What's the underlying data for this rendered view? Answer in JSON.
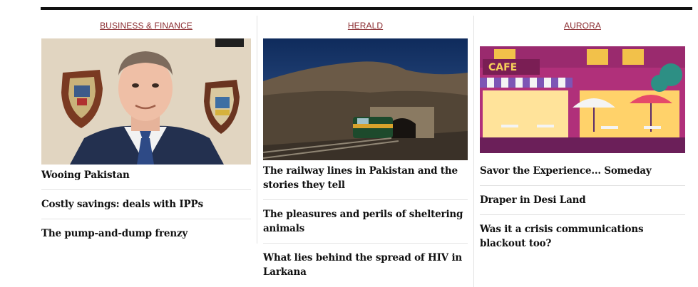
{
  "columns": [
    {
      "section": "BUSINESS & FINANCE",
      "image_icon": "portrait-photo",
      "stories": [
        "Wooing Pakistan",
        "Costly savings: deals with IPPs",
        "The pump-and-dump frenzy"
      ]
    },
    {
      "section": "HERALD",
      "image_icon": "train-tunnel-photo",
      "stories": [
        "The railway lines in Pakistan and the stories they tell",
        "The pleasures and perils of sheltering animals",
        "What lies behind the spread of HIV in Larkana"
      ]
    },
    {
      "section": "AURORA",
      "image_icon": "cafe-illustration",
      "cafe_sign": "CAFE",
      "stories": [
        "Savor the Experience... Someday",
        "Draper in Desi Land",
        "Was it a crisis communications blackout too?"
      ]
    }
  ],
  "colors": {
    "section_link": "#8a2b2f",
    "rule": "#111111",
    "divider": "#e3e3e3"
  }
}
